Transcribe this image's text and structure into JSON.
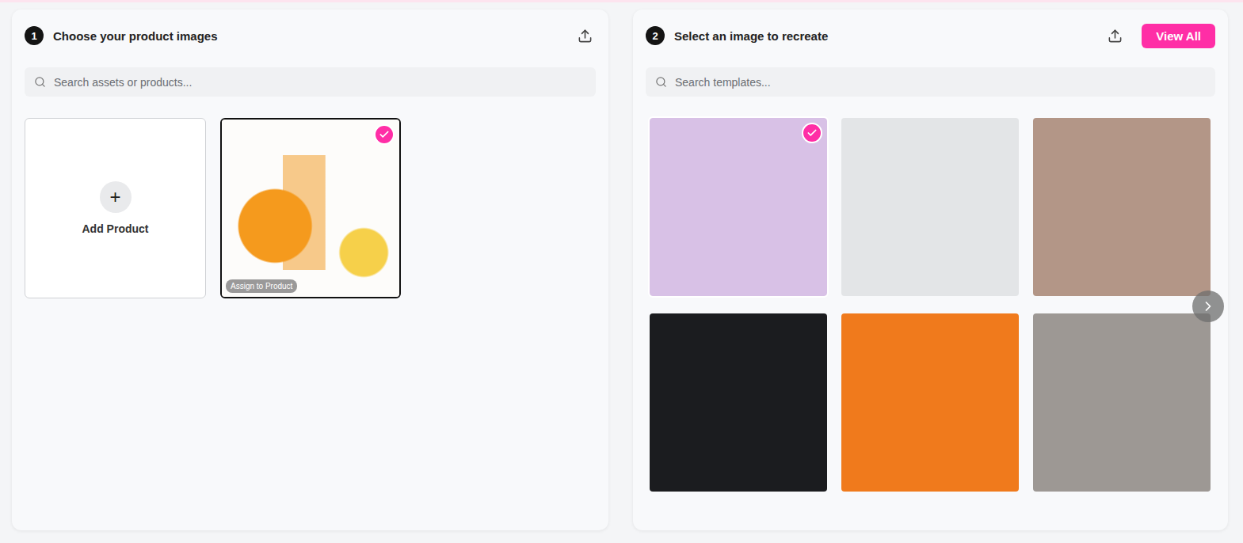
{
  "product_panel": {
    "step": "1",
    "title": "Choose your product images",
    "search": {
      "placeholder": "Search assets or products..."
    },
    "add_card": {
      "icon": "+",
      "label": "Add Product"
    },
    "products": [
      {
        "selected": true,
        "badge": "Assign to Product",
        "color": "#f6ead8"
      }
    ]
  },
  "template_panel": {
    "step": "2",
    "title": "Select an image to recreate",
    "button": "View All",
    "search": {
      "placeholder": "Search templates..."
    },
    "templates": [
      {
        "selected": true,
        "color": "#d8c1e6"
      },
      {
        "selected": false,
        "color": "#e3e5e7"
      },
      {
        "selected": false,
        "color": "#b39687"
      },
      {
        "selected": false,
        "color": "#1b1c1f"
      },
      {
        "selected": false,
        "color": "#f07a1c"
      },
      {
        "selected": false,
        "color": "#9d9894"
      }
    ]
  }
}
